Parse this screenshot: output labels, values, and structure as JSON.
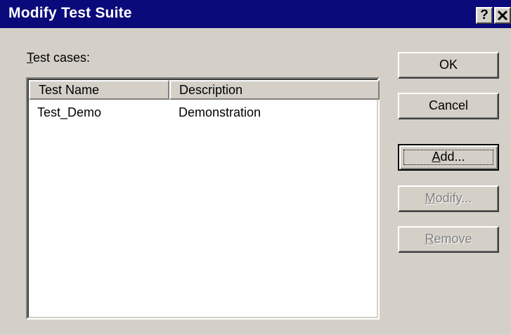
{
  "window": {
    "title": "Modify Test Suite",
    "help_glyph": "?",
    "close_glyph": "✕"
  },
  "test_cases": {
    "label_mnemonic": "T",
    "label_rest": "est cases:",
    "columns": [
      "Test Name",
      "Description"
    ],
    "rows": [
      {
        "name": "Test_Demo",
        "description": "Demonstration"
      }
    ]
  },
  "buttons": {
    "ok": "OK",
    "cancel": "Cancel",
    "add_mnemonic": "A",
    "add_rest": "dd...",
    "modify_mnemonic": "M",
    "modify_rest": "odify...",
    "remove_mnemonic": "R",
    "remove_rest": "emove"
  },
  "colors": {
    "titlebar": "#0a0a7a",
    "face": "#d4d0c8",
    "disabled_text": "#808080"
  },
  "icons": [
    "help-icon",
    "close-icon"
  ]
}
